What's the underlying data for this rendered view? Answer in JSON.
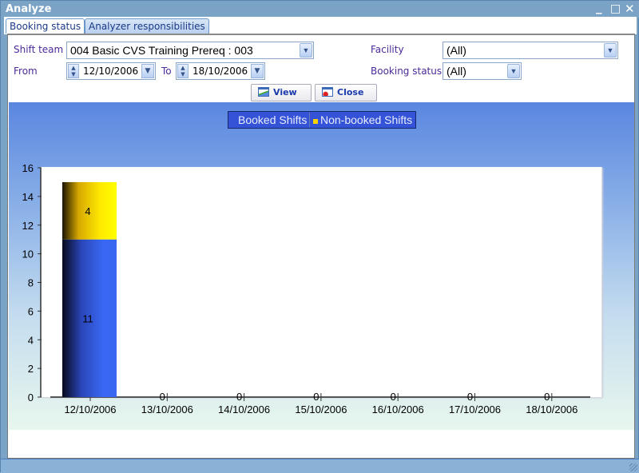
{
  "window": {
    "title": "Analyze",
    "controls": [
      "_",
      "□",
      "✕"
    ]
  },
  "tabs": [
    {
      "label": "Booking status",
      "active": true
    },
    {
      "label": "Analyzer responsibilities",
      "active": false
    }
  ],
  "form": {
    "shift_team_label": "Shift team",
    "shift_team_value": "004 Basic CVS Training Prereq : 003",
    "from_label": "From",
    "from_value": "12/10/2006",
    "to_label": "To",
    "to_value": "18/10/2006",
    "facility_label": "Facility",
    "facility_value": "(All)",
    "booking_status_label": "Booking status",
    "booking_status_value": "(All)"
  },
  "buttons": {
    "view": "View",
    "close": "Close"
  },
  "colors": {
    "booked": "#3a66f0",
    "non_booked": "#ffd200",
    "accent": "#4b2a9a"
  },
  "chart_data": {
    "type": "bar",
    "stacked": true,
    "categories": [
      "12/10/2006",
      "13/10/2006",
      "14/10/2006",
      "15/10/2006",
      "16/10/2006",
      "17/10/2006",
      "18/10/2006"
    ],
    "series": [
      {
        "name": "Booked Shifts",
        "values": [
          11,
          0,
          0,
          0,
          0,
          0,
          0
        ]
      },
      {
        "name": "Non-booked Shifts",
        "values": [
          4,
          0,
          0,
          0,
          0,
          0,
          0
        ]
      }
    ],
    "data_labels": [
      "11",
      "4",
      "0",
      "0",
      "0",
      "0",
      "0",
      "0"
    ],
    "legend_position": "top-center",
    "ylim": [
      0,
      16
    ],
    "yticks": [
      0,
      2,
      4,
      6,
      8,
      10,
      12,
      14,
      16
    ],
    "title": "",
    "xlabel": "",
    "ylabel": ""
  }
}
